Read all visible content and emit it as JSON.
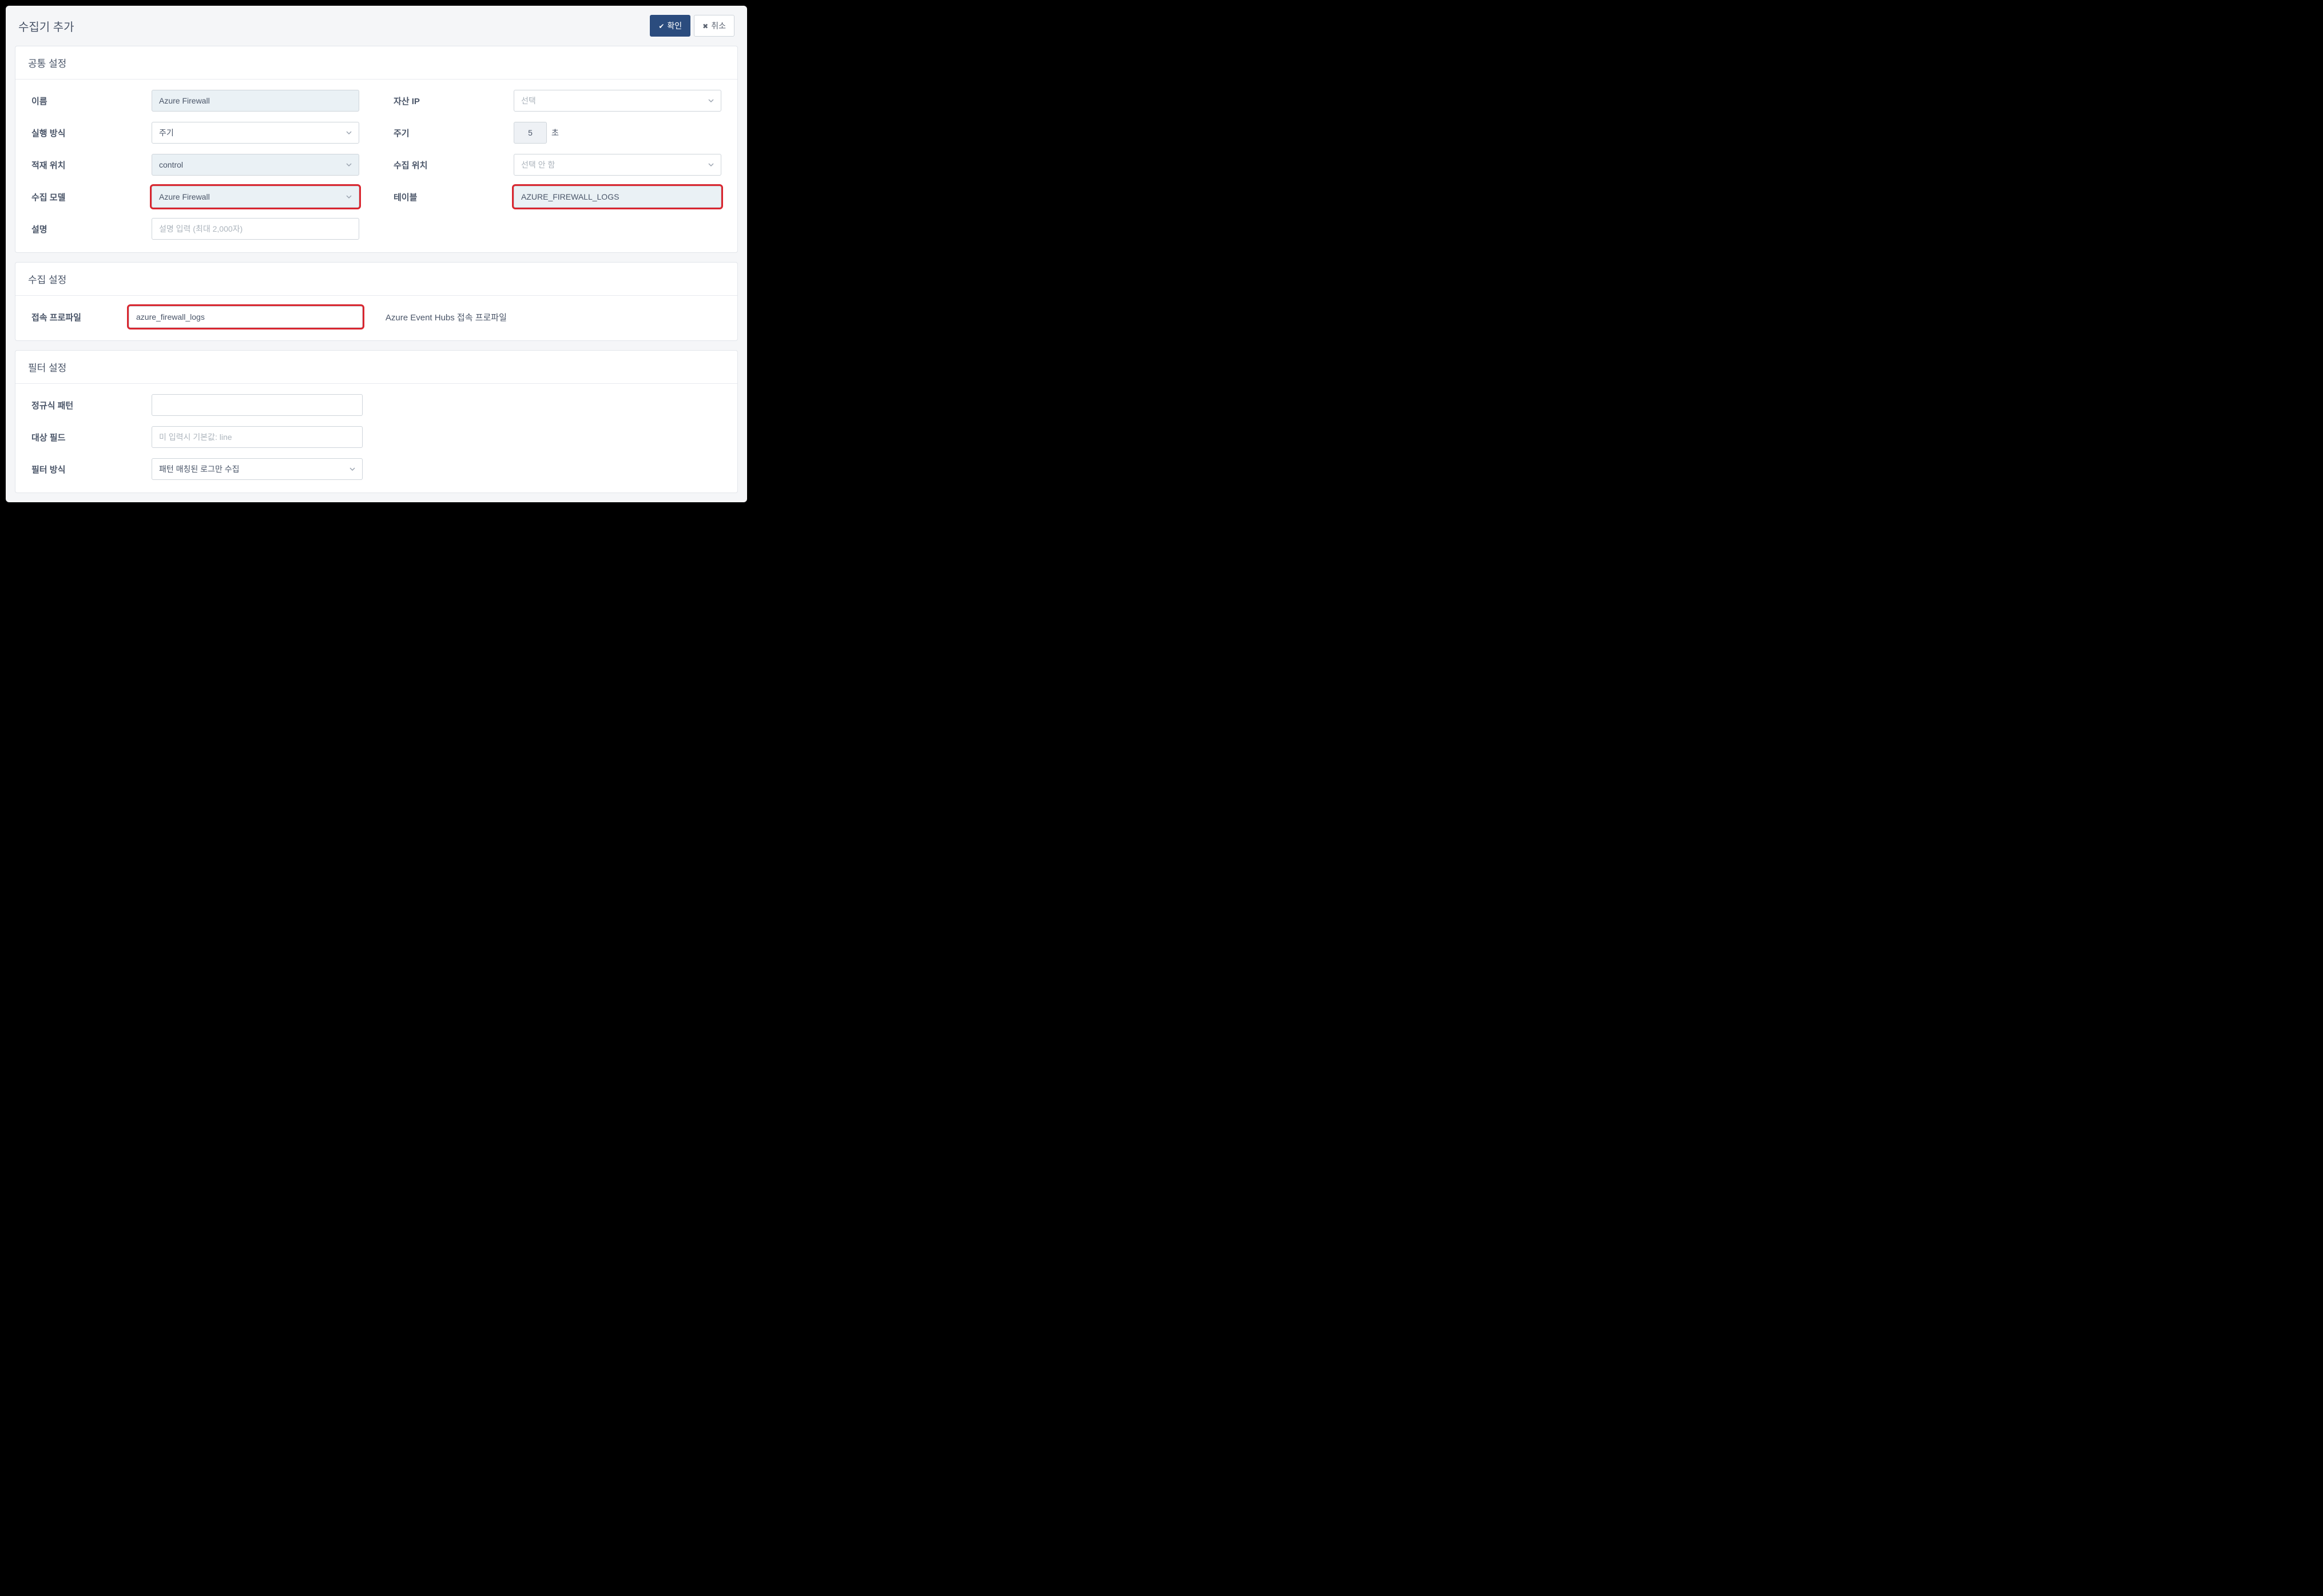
{
  "dialog": {
    "title": "수집기 추가",
    "confirm": "확인",
    "cancel": "취소"
  },
  "common": {
    "section_title": "공통 설정",
    "name_label": "이름",
    "name_value": "Azure Firewall",
    "asset_ip_label": "자산 IP",
    "asset_ip_placeholder": "선택",
    "run_mode_label": "실행 방식",
    "run_mode_value": "주기",
    "interval_label": "주기",
    "interval_value": "5",
    "interval_unit": "초",
    "load_loc_label": "적재 위치",
    "load_loc_value": "control",
    "collect_loc_label": "수집 위치",
    "collect_loc_placeholder": "선택 안 함",
    "collect_model_label": "수집 모델",
    "collect_model_value": "Azure Firewall",
    "table_label": "테이블",
    "table_value": "AZURE_FIREWALL_LOGS",
    "desc_label": "설명",
    "desc_placeholder": "설명 입력 (최대 2,000자)"
  },
  "collect": {
    "section_title": "수집 설정",
    "profile_label": "접속 프로파일",
    "profile_value": "azure_firewall_logs",
    "profile_hint": "Azure Event Hubs 접속 프로파일"
  },
  "filter": {
    "section_title": "필터 설정",
    "regex_label": "정규식 패턴",
    "target_field_label": "대상 필드",
    "target_field_placeholder": "미 입력시 기본값: line",
    "mode_label": "필터 방식",
    "mode_value": "패턴 매칭된 로그만 수집"
  }
}
